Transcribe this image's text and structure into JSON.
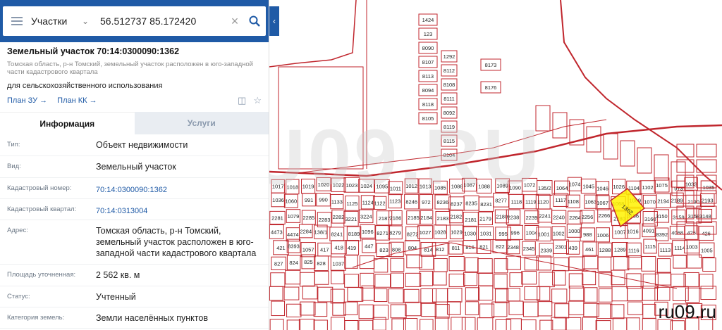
{
  "search": {
    "category": "Участки",
    "query": "56.512737 85.172420"
  },
  "parcel": {
    "title": "Земельный участок 70:14:0300090:1362",
    "address_short": "Томская область, р-н Томский, земельный участок расположен в юго-западной части кадастрового квартала",
    "usage": "для сельскохозяйственного использования",
    "plan_zu": "План ЗУ",
    "plan_kk": "План КК"
  },
  "tabs": {
    "info": "Информация",
    "services": "Услуги"
  },
  "info": [
    {
      "key": "Тип:",
      "value": "Объект недвижимости"
    },
    {
      "key": "Вид:",
      "value": "Земельный участок"
    },
    {
      "key": "Кадастровый номер:",
      "value": "70:14:0300090:1362"
    },
    {
      "key": "Кадастровый квартал:",
      "value": "70:14:0313004"
    },
    {
      "key": "Адрес:",
      "value": "Томская область, р-н Томский, земельный участок расположен в юго-западной части кадастрового квартала"
    },
    {
      "key": "Площадь уточненная:",
      "value": "2 562 кв. м"
    },
    {
      "key": "Статус:",
      "value": "Учтенный"
    },
    {
      "key": "Категория земель:",
      "value": "Земли населённых пунктов"
    }
  ],
  "map": {
    "watermark": "RU09.RU",
    "brand": "ru09.ru",
    "highlight_label": "1362",
    "labels": [
      "1424",
      "1292",
      "123",
      "8112",
      "8090",
      "8108",
      "8107",
      "8111",
      "8113",
      "8092",
      "8094",
      "8119",
      "8118",
      "8115",
      "8105",
      "8104",
      "8173",
      "8176",
      "1017",
      "1018",
      "1019",
      "1020",
      "1022",
      "1023",
      "1024",
      "1095",
      "1011",
      "1012",
      "1013",
      "1085",
      "1086",
      "1087",
      "1088",
      "1089",
      "1090",
      "1072",
      "135/2",
      "1064",
      "1074",
      "1045",
      "1046",
      "1026",
      "1104",
      "1102",
      "1075",
      "973",
      "1033",
      "1035",
      "1036",
      "1060",
      "991",
      "990",
      "1133",
      "1125",
      "1124",
      "1122",
      "1123",
      "8246",
      "972",
      "8236",
      "8237",
      "8235",
      "8231",
      "8277",
      "1118",
      "1119",
      "1120",
      "1117",
      "1108",
      "1063",
      "1067",
      "1068",
      "1069",
      "1070",
      "2194",
      "2189",
      "2190",
      "2193",
      "2281",
      "1079",
      "2285",
      "2283",
      "2282",
      "3221",
      "3224",
      "2187",
      "2186",
      "2185",
      "2184",
      "2183",
      "2182",
      "2181",
      "2179",
      "2180",
      "2238",
      "2239",
      "2241",
      "2240",
      "2264",
      "2256",
      "2266",
      "2280",
      "3156",
      "3160",
      "3150",
      "3159",
      "3158",
      "3148",
      "4473",
      "4474",
      "2284",
      "138/1",
      "8241",
      "8189",
      "1096",
      "8271",
      "8279",
      "8272",
      "1027",
      "1028",
      "1029",
      "1030",
      "1031",
      "995",
      "996",
      "1004",
      "1001",
      "1002",
      "1000",
      "988",
      "1006",
      "1007",
      "1016",
      "4091",
      "8392",
      "4068",
      "425",
      "426",
      "421",
      "8393",
      "1057",
      "417",
      "418",
      "419",
      "447",
      "823",
      "808",
      "804",
      "814",
      "812",
      "811",
      "816",
      "821",
      "822",
      "2348",
      "2345",
      "2339",
      "2301",
      "439",
      "461",
      "1288",
      "1289",
      "1116",
      "1115",
      "1113",
      "1114",
      "1003",
      "1005",
      "827",
      "824",
      "825",
      "828",
      "1037"
    ]
  }
}
